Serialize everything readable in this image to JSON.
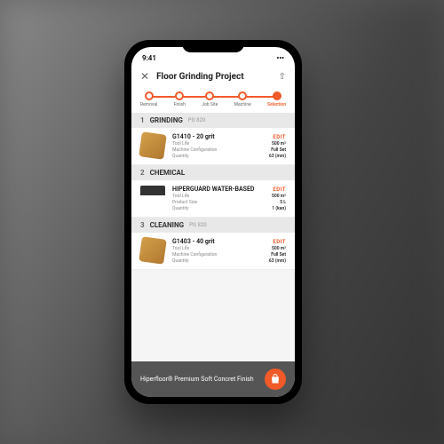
{
  "status": {
    "time": "9:41"
  },
  "header": {
    "title": "Floor Grinding Project"
  },
  "steps": [
    {
      "label": "Removal"
    },
    {
      "label": "Finish"
    },
    {
      "label": "Job Site"
    },
    {
      "label": "Machine"
    },
    {
      "label": "Selection"
    }
  ],
  "sections": [
    {
      "num": "1",
      "title": "GRINDING",
      "sub": "PG 820",
      "product": {
        "name": "G1410 - 20 grit",
        "edit": "EDIT",
        "rows": [
          {
            "label": "Tool Life",
            "value": "500 m²"
          },
          {
            "label": "Machine Configuration",
            "value": "Full Set"
          },
          {
            "label": "Quantity",
            "value": "63 (mm)"
          }
        ]
      }
    },
    {
      "num": "2",
      "title": "CHEMICAL",
      "sub": "",
      "product": {
        "name": "HIPERGUARD WATER-BASED",
        "edit": "EDIT",
        "rows": [
          {
            "label": "Tool Life",
            "value": "500 m²"
          },
          {
            "label": "Product Size",
            "value": "5 L"
          },
          {
            "label": "Quantity",
            "value": "1 (kan)"
          }
        ]
      }
    },
    {
      "num": "3",
      "title": "CLEANING",
      "sub": "PG 820",
      "product": {
        "name": "G1403 - 40 grit",
        "edit": "EDIT",
        "rows": [
          {
            "label": "Tool Life",
            "value": "500 m²"
          },
          {
            "label": "Machine Configuration",
            "value": "Full Set"
          },
          {
            "label": "Quantity",
            "value": "63 (mm)"
          }
        ]
      }
    }
  ],
  "footer": {
    "text": "Hiperfloor® Premium Soft Concret Finish"
  }
}
